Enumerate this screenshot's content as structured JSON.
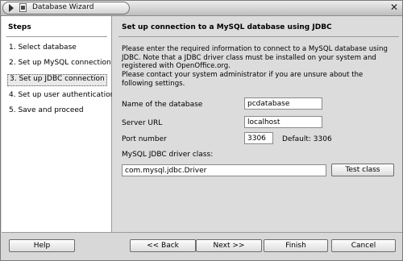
{
  "window": {
    "title": "Database Wizard",
    "close_glyph": "✕"
  },
  "sidebar": {
    "heading": "Steps",
    "items": [
      {
        "label": "1. Select database"
      },
      {
        "label": "2. Set up MySQL connection"
      },
      {
        "label": "3. Set up JDBC connection",
        "active": true
      },
      {
        "label": "4. Set up user authentication"
      },
      {
        "label": "5. Save and proceed"
      }
    ]
  },
  "main": {
    "title": "Set up connection to a MySQL database using JDBC",
    "intro_1": "Please enter the required information to connect to a MySQL database using JDBC. Note that a JDBC driver class must be installed on your system and registered with OpenOffice.org.",
    "intro_2": "Please contact your system administrator if you are unsure about the following settings.",
    "db_name_label": "Name of the database",
    "db_name_value": "pcdatabase",
    "server_url_label": "Server URL",
    "server_url_value": "localhost",
    "port_label": "Port number",
    "port_value": "3306",
    "port_default": "Default: 3306",
    "driver_label": "MySQL JDBC driver class:",
    "driver_value": "com.mysql.jdbc.Driver",
    "test_class_button": "Test class"
  },
  "footer": {
    "help": "Help",
    "back": "<< Back",
    "next": "Next >>",
    "finish": "Finish",
    "cancel": "Cancel"
  },
  "icons": {
    "title_arrow": "triangle-right-icon",
    "app": "database-icon",
    "close": "close-icon"
  }
}
